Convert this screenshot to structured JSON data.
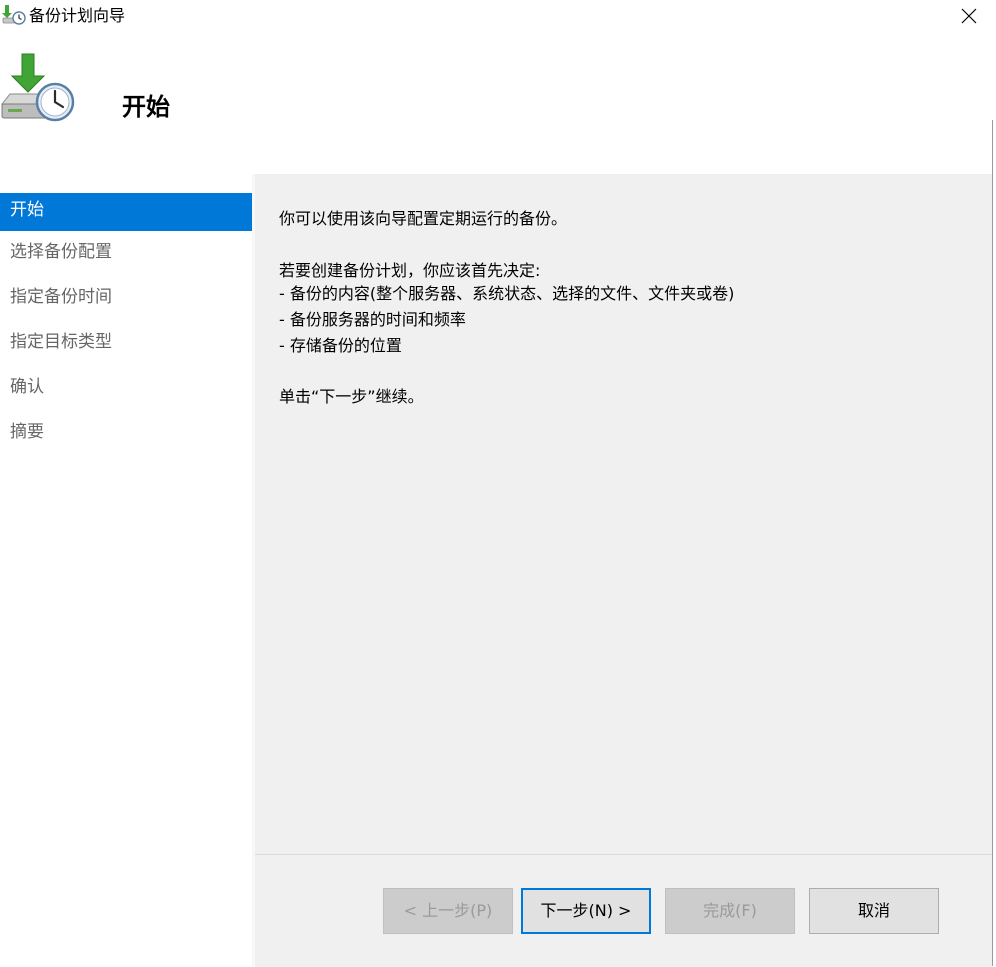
{
  "window": {
    "title": "备份计划向导",
    "icon": "backup-schedule-icon",
    "close_icon": "close-icon"
  },
  "header": {
    "title": "开始",
    "icon": "backup-drive-clock-icon"
  },
  "nav": {
    "items": [
      {
        "label": "开始",
        "active": true
      },
      {
        "label": "选择备份配置",
        "active": false
      },
      {
        "label": "指定备份时间",
        "active": false
      },
      {
        "label": "指定目标类型",
        "active": false
      },
      {
        "label": "确认",
        "active": false
      },
      {
        "label": "摘要",
        "active": false
      }
    ]
  },
  "content": {
    "intro": "你可以使用该向导配置定期运行的备份。",
    "decide_heading": "若要创建备份计划，你应该首先决定:",
    "bullets": [
      "- 备份的内容(整个服务器、系统状态、选择的文件、文件夹或卷)",
      "- 备份服务器的时间和频率",
      "- 存储备份的位置"
    ],
    "continue_text": "单击“下一步”继续。"
  },
  "buttons": {
    "prev": "< 上一步(P)",
    "next": "下一步(N) >",
    "finish": "完成(F)",
    "cancel": "取消"
  },
  "colors": {
    "accent": "#0078d7",
    "content_bg": "#f0f0f0",
    "disabled_text": "#9a9a9a"
  }
}
